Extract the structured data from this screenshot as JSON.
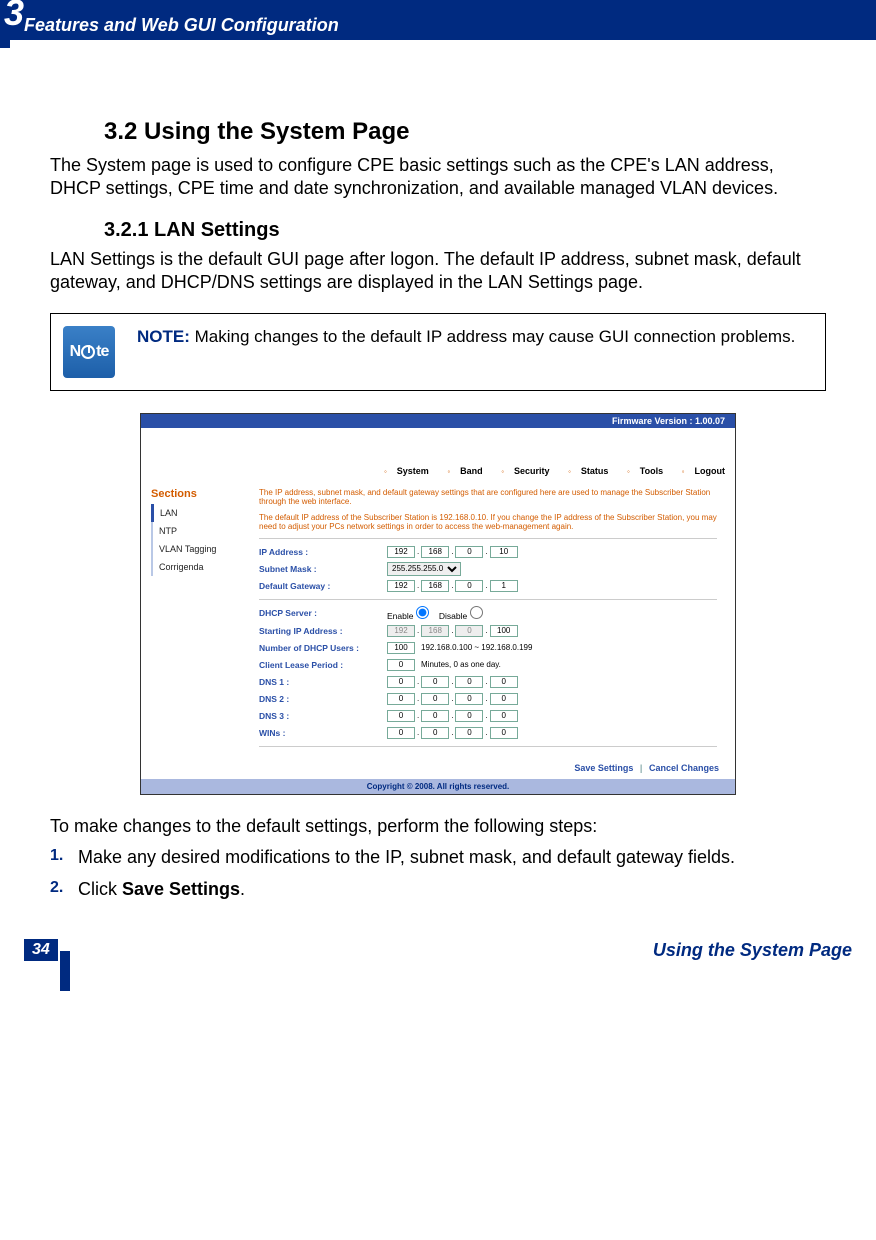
{
  "chapterNumber": "3",
  "headerTitle": "Features and Web GUI Configuration",
  "h2": "3.2 Using the System Page",
  "intro": "The System page is used to configure CPE basic settings such as the CPE's LAN address, DHCP settings, CPE time and date synchronization, and available managed VLAN devices.",
  "h3": "3.2.1 LAN Settings",
  "lanIntro": "LAN Settings is the default GUI page after logon. The default IP address, subnet mask, default gateway, and DHCP/DNS settings are displayed in the LAN Settings page.",
  "note": {
    "label": "NOTE:",
    "text": " Making changes to the default IP address may cause GUI connection problems."
  },
  "screenshot": {
    "firmwareBar": "Firmware Version : 1.00.07",
    "menu": [
      "System",
      "Band",
      "Security",
      "Status",
      "Tools",
      "Logout"
    ],
    "sectionsLabel": "Sections",
    "nav": [
      "LAN",
      "NTP",
      "VLAN Tagging",
      "Corrigenda"
    ],
    "topNote1": "The IP address, subnet mask, and default gateway settings that are configured here are used to manage the Subscriber Station through the web interface.",
    "topNote2": "The default IP address of the Subscriber Station is 192.168.0.10. If you change the IP address of the Subscriber Station, you may need to adjust your PCs network settings in order to access the web-management again.",
    "labels": {
      "ip": "IP Address :",
      "subnet": "Subnet Mask :",
      "gateway": "Default Gateway :",
      "dhcp": "DHCP Server :",
      "startIp": "Starting IP Address :",
      "numUsers": "Number of DHCP Users :",
      "lease": "Client Lease Period :",
      "dns1": "DNS 1 :",
      "dns2": "DNS 2 :",
      "dns3": "DNS 3 :",
      "wins": "WINs :"
    },
    "values": {
      "ip": [
        "192",
        "168",
        "0",
        "10"
      ],
      "subnet": "255.255.255.0",
      "gateway": [
        "192",
        "168",
        "0",
        "1"
      ],
      "enable": "Enable",
      "disable": "Disable",
      "startIp": [
        "192",
        "168",
        "0",
        "100"
      ],
      "numUsers": "100",
      "usersRange": "192.168.0.100 ~ 192.168.0.199",
      "lease": "0",
      "leaseSuffix": "Minutes, 0 as one day.",
      "dns1": [
        "0",
        "0",
        "0",
        "0"
      ],
      "dns2": [
        "0",
        "0",
        "0",
        "0"
      ],
      "dns3": [
        "0",
        "0",
        "0",
        "0"
      ],
      "wins": [
        "0",
        "0",
        "0",
        "0"
      ]
    },
    "saveBtn": "Save Settings",
    "cancelBtn": "Cancel Changes",
    "copyright": "Copyright © 2008.  All rights reserved."
  },
  "stepsIntro": "To make changes to the default settings, perform the following steps:",
  "steps": [
    {
      "num": "1.",
      "text": "Make any desired modifications to the IP, subnet mask, and default gateway fields."
    },
    {
      "num": "2.",
      "prefix": "Click ",
      "bold": "Save Settings",
      "suffix": "."
    }
  ],
  "footer": {
    "pageNum": "34",
    "title": "Using the System Page"
  }
}
